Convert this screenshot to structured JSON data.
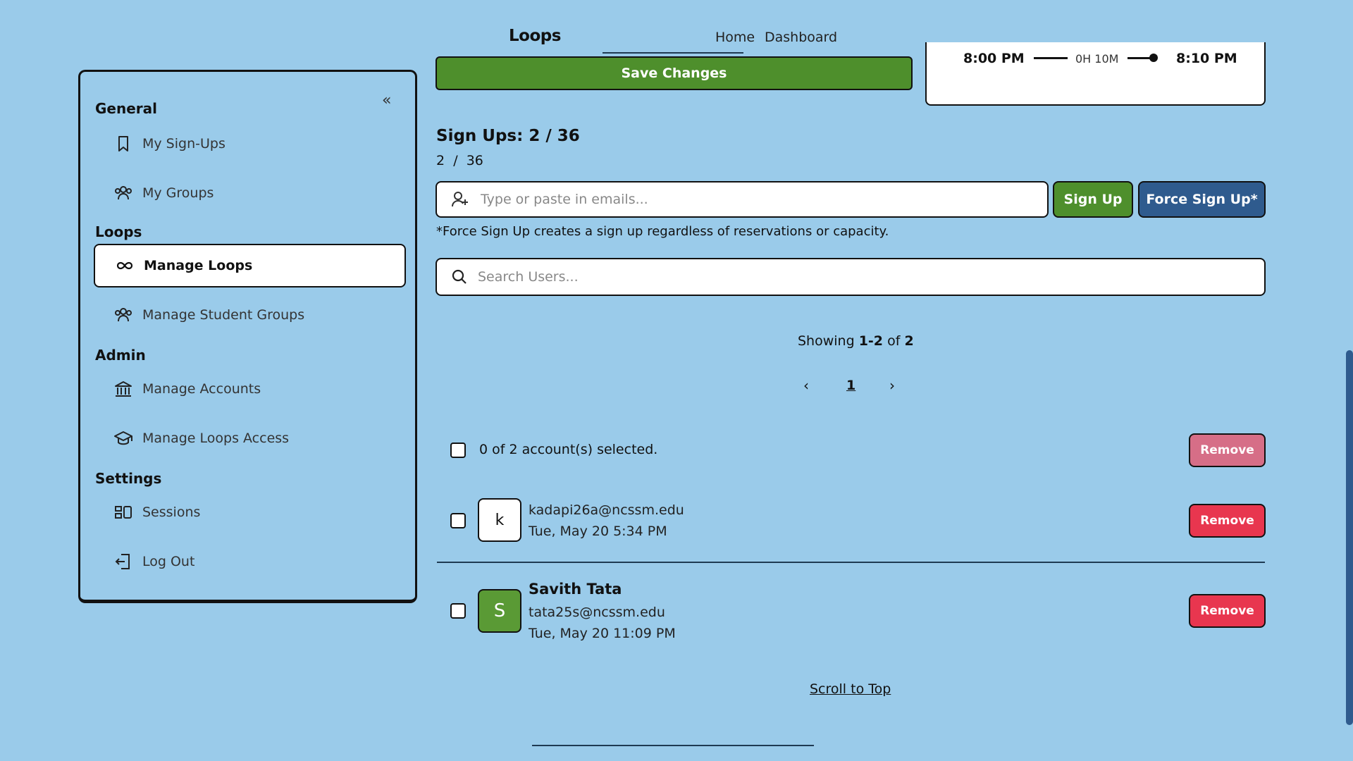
{
  "nav": {
    "brand": "Loops",
    "links": [
      "Home",
      "Dashboard"
    ]
  },
  "sidebar": {
    "sections": [
      {
        "title": "General",
        "items": [
          {
            "label": "My Sign-Ups",
            "icon": "bookmark-icon"
          },
          {
            "label": "My Groups",
            "icon": "groups-icon"
          }
        ]
      },
      {
        "title": "Loops",
        "items": [
          {
            "label": "Manage Loops",
            "icon": "infinity-icon",
            "active": true
          },
          {
            "label": "Manage Student Groups",
            "icon": "groups-icon"
          }
        ]
      },
      {
        "title": "Admin",
        "items": [
          {
            "label": "Manage Accounts",
            "icon": "bank-icon"
          },
          {
            "label": "Manage Loops Access",
            "icon": "graduation-cap-icon"
          }
        ]
      },
      {
        "title": "Settings",
        "items": [
          {
            "label": "Sessions",
            "icon": "sessions-icon"
          },
          {
            "label": "Log Out",
            "icon": "logout-icon"
          }
        ]
      }
    ],
    "collapse_symbol": "«"
  },
  "actions": {
    "save_label": "Save Changes"
  },
  "time_card": {
    "start": "8:00 PM",
    "duration": "0H 10M",
    "end": "8:10 PM"
  },
  "signups": {
    "title": "Sign Ups: 2 / 36",
    "count_current": "2",
    "count_separator": "/",
    "count_total": "36",
    "email_placeholder": "Type or paste in emails...",
    "signup_label": "Sign Up",
    "force_label": "Force Sign Up*",
    "force_note": "*Force Sign Up creates a sign up regardless of reservations or capacity."
  },
  "search": {
    "placeholder": "Search Users..."
  },
  "pagination": {
    "showing_prefix": "Showing",
    "range": "1-2",
    "of_label": "of",
    "total": "2",
    "current_page": "1",
    "prev": "‹",
    "next": "›"
  },
  "selection": {
    "text": "0 of 2 account(s) selected.",
    "remove_label": "Remove"
  },
  "users": [
    {
      "initial": "k",
      "name": "",
      "email": "kadapi26a@ncssm.edu",
      "date": "Tue, May 20 5:34 PM",
      "avatar_color": "#ffffff",
      "remove_label": "Remove"
    },
    {
      "initial": "S",
      "name": "Savith Tata",
      "email": "tata25s@ncssm.edu",
      "date": "Tue, May 20 11:09 PM",
      "avatar_color": "#5a9a35",
      "remove_label": "Remove"
    }
  ],
  "footer": {
    "scroll_top": "Scroll to Top"
  },
  "colors": {
    "background": "#9acbea",
    "green": "#4e8f2c",
    "blue": "#2f5b8e",
    "red": "#e8364f"
  }
}
